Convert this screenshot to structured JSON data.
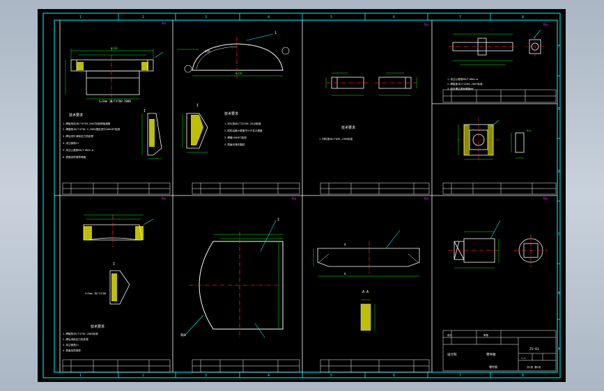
{
  "frame": {
    "zone_numbers": [
      "1",
      "2",
      "3",
      "4",
      "5",
      "6",
      "7",
      "8"
    ],
    "zone_letters_right": [
      "A",
      "B",
      "C",
      "D",
      "E",
      "F"
    ]
  },
  "panels": {
    "p1": {
      "note_title": "技术要求",
      "notes": [
        "1.焊接采用JB/T4709-2007标准焊接规程",
        "2.焊缝按JB/T4730.2-2005规定进行100%RT检测",
        "3.焊后进行消除应力热处理",
        "4.未注倒角C1",
        "5.未注公差按GB/T1804-m",
        "6.表面涂防锈漆两遍"
      ],
      "weld_label": "S=5mm JB/T4700-2000"
    },
    "p2": {
      "note_title": "技术要求",
      "notes": [
        "1.封头按GB/T25198-2010制造",
        "2.成形后最小厚度不小于名义厚度",
        "3.焊缝100%RT检测",
        "4.表面光滑无裂纹"
      ],
      "part_label": "封头"
    },
    "p3": {
      "note_title": "技术要求",
      "notes": [
        "1.材料按GB/T699-1999标准"
      ]
    },
    "p4": {
      "notes": [
        "1.未注公差按GB/T1804-m",
        "2.焊接按JB/T4709-2007标准",
        "3.热处理后表面硬度HB"
      ]
    },
    "p5": {
      "labels": [
        "设计",
        "审核"
      ]
    },
    "p6": {
      "note_title": "技术要求",
      "notes": [
        "1.焊缝按JB/T4730-2005检测",
        "2.焊后消除应力热处理",
        "3.未注倒角C1",
        "4.表面涂防锈漆"
      ],
      "weld_label": "S=5mm JB/T4700"
    },
    "p7": {
      "labels": [
        "筒体"
      ]
    },
    "p8": {
      "section_label": "A-A",
      "labels": [
        "A",
        "A"
      ]
    },
    "p9": {
      "labels": [
        "零件图"
      ]
    }
  },
  "title_block": {
    "company": "设计院",
    "drawing_title": "零件图",
    "drawing_no": "ZS-01",
    "scale": "1:1",
    "sheet": "共1张 第1张"
  },
  "colors": {
    "frame": "#00ffff",
    "geometry": "#ffffff",
    "centerline": "#ff2020",
    "dimension": "#00ff00",
    "leader": "#00ffff",
    "hatch": "#ffff00",
    "accent": "#ff00ff",
    "text": "#ffffff"
  }
}
